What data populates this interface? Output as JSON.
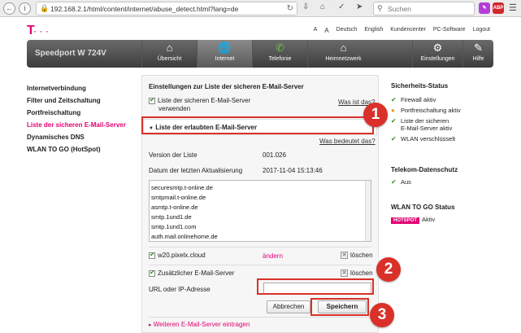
{
  "browser": {
    "url": "192.168.2.1/html/content/internet/abuse_detect.html?lang=de",
    "search_placeholder": "Suchen",
    "ext_badge": "ABP"
  },
  "header": {
    "logo": "T",
    "logo_dots": "· · ·",
    "links": [
      "A",
      "A",
      "Deutsch",
      "English",
      "Kundencenter",
      "PC-Software",
      "Logout"
    ],
    "model": "Speedport W 724V"
  },
  "nav": [
    {
      "label": "Übersicht",
      "icon": "home-icon"
    },
    {
      "label": "Internet",
      "icon": "globe-icon"
    },
    {
      "label": "Telefonie",
      "icon": "phone-icon"
    },
    {
      "label": "Heimnetzwerk",
      "icon": "network-icon"
    },
    {
      "label": "Einstellungen",
      "icon": "gear-icon"
    },
    {
      "label": "Hilfe",
      "icon": "help-icon"
    }
  ],
  "sidebar": {
    "items": [
      {
        "label": "Internetverbindung"
      },
      {
        "label": "Filter und Zeitschaltung"
      },
      {
        "label": "Portfreischaltung"
      },
      {
        "label": "Liste der sicheren E-Mail-Server"
      },
      {
        "label": "Dynamisches DNS"
      },
      {
        "label": "WLAN TO GO (HotSpot)"
      }
    ]
  },
  "main": {
    "title": "Einstellungen zur Liste der sicheren E-Mail-Server",
    "use_list_line1": "Liste der sicheren E-Mail-Server",
    "use_list_line2": "verwenden",
    "was_ist_das": "Was ist das?",
    "section_title": "Liste der erlaubten E-Mail-Server",
    "was_bedeutet": "Was bedeutet das?",
    "version_label": "Version der Liste",
    "version_value": "001.026",
    "date_label": "Datum der letzten Aktualisierung",
    "date_value": "2017-11-04 15:13:46",
    "servers": [
      "securesmtp.t-online.de",
      "smtpmail.t-online.de",
      "asmtp.t-online.de",
      "smtp.1und1.de",
      "smtp.1und1.com",
      "auth.mail.onlinehome.de"
    ],
    "custom_server": "w20.pixelx.cloud",
    "aendern": "ändern",
    "loeschen": "löschen",
    "additional_label": "Zusätzlicher E-Mail-Server",
    "url_label": "URL oder IP-Adresse",
    "url_value": "",
    "cancel": "Abbrechen",
    "save": "Speichern",
    "add_more": "Weiteren E-Mail-Server eintragen"
  },
  "status": {
    "title": "Sicherheits-Status",
    "items": [
      "Firewall aktiv",
      "Portfreischaltung aktiv",
      "Liste der sicheren",
      "E-Mail-Server aktiv",
      "WLAN verschlüsselt"
    ],
    "privacy_title": "Telekom-Datenschutz",
    "privacy_value": "Aus",
    "wlan_title": "WLAN TO GO Status",
    "hotspot_badge": "HOTSPOT",
    "hotspot_value": "Aktiv"
  },
  "callouts": [
    "1",
    "2",
    "3"
  ],
  "colors": {
    "accent": "#e20074",
    "callout": "#d9312a"
  }
}
